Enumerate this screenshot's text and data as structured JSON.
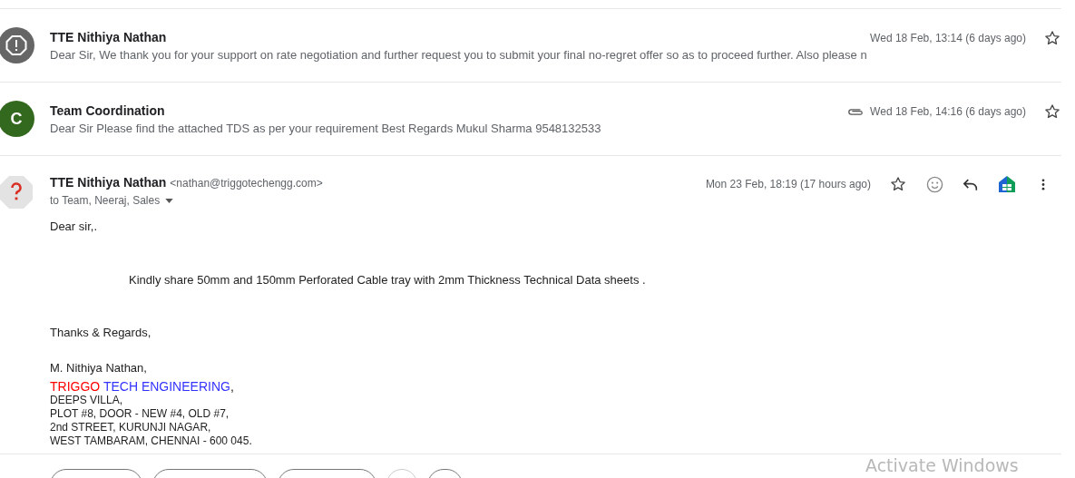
{
  "threads": [
    {
      "sender": "TTE Nithiya Nathan",
      "snippet": "Dear Sir, We thank you for your support on rate negotiation and further request you to submit your final no-regret offer so as to proceed further. Also please n",
      "date": "Wed 18 Feb, 13:14 (6 days ago)",
      "attachment": false,
      "starred": false,
      "avatar": {
        "kind": "alert"
      }
    },
    {
      "sender": "Team Coordination",
      "snippet": "Dear Sir Please find the attached TDS as per your requirement Best Regards Mukul Sharma 9548132533",
      "date": "Wed 18 Feb, 14:16 (6 days ago)",
      "attachment": true,
      "starred": false,
      "avatar": {
        "kind": "letter",
        "letter": "C",
        "color": "#33691e"
      }
    }
  ],
  "open_message": {
    "sender": "TTE Nithiya Nathan",
    "email": "<nathan@triggotechengg.com>",
    "recipients": "to Team, Neeraj, Sales",
    "date": "Mon 23 Feb, 18:19 (17 hours ago)",
    "starred": false,
    "greeting": "Dear sir,.",
    "paragraph": "Kindly share 50mm and 150mm Perforated Cable tray with 2mm Thickness Technical Data sheets .",
    "closing": "Thanks & Regards,",
    "signature_name": "M. Nithiya Nathan,",
    "company": {
      "first": "TRIGGO",
      "second": "TECH ENGINEERING",
      "suffix": ","
    },
    "address": [
      "DEEPS VILLA,",
      "PLOT #8, DOOR - NEW #4, OLD #7,",
      "2nd STREET, KURUNJI NAGAR,",
      "WEST TAMBARAM, CHENNAI - 600 045."
    ]
  },
  "action_buttons": [
    {
      "kind": "pill"
    },
    {
      "kind": "pill"
    },
    {
      "kind": "pill"
    },
    {
      "kind": "circle"
    },
    {
      "kind": "pill"
    }
  ],
  "activation_notice": "Activate Windows"
}
